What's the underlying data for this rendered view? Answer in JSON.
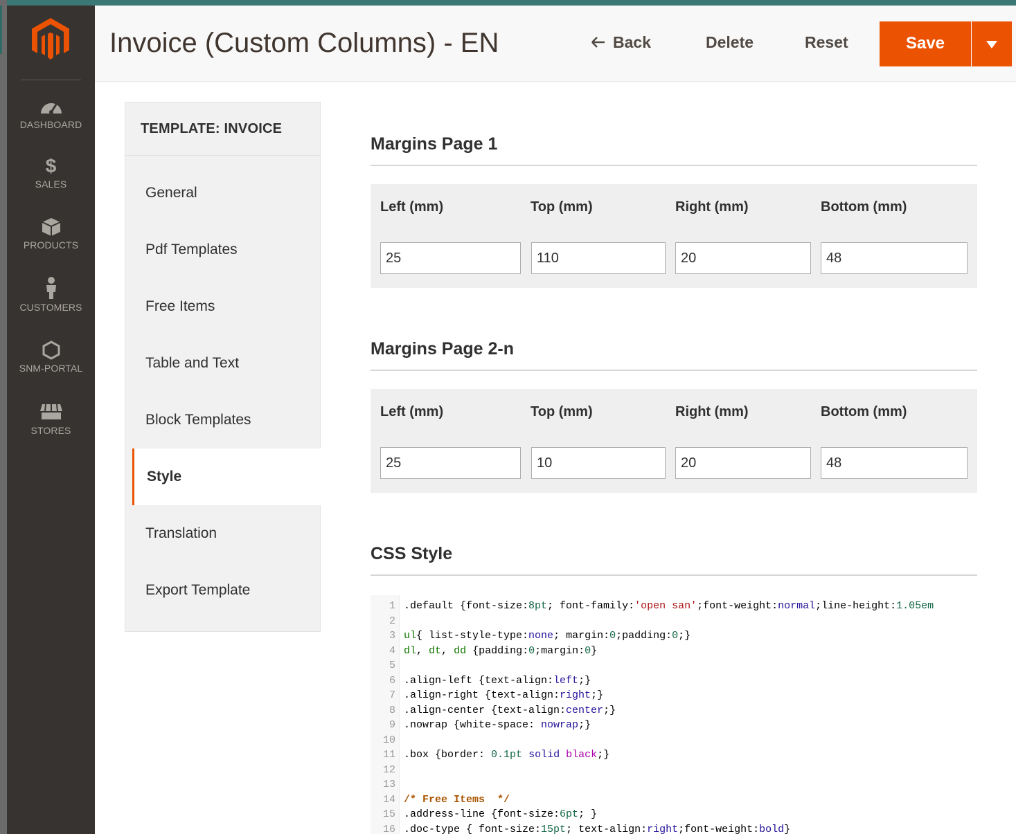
{
  "colors": {
    "accent": "#eb5202",
    "sidebar_bg": "#373330",
    "header_bg": "#f8f8f8"
  },
  "sidebar": {
    "logo_icon": "magento-logo-icon",
    "items": [
      {
        "label": "DASHBOARD",
        "icon": "dashboard-icon"
      },
      {
        "label": "SALES",
        "icon": "dollar-icon"
      },
      {
        "label": "PRODUCTS",
        "icon": "box-icon"
      },
      {
        "label": "CUSTOMERS",
        "icon": "person-icon"
      },
      {
        "label": "SNM-PORTAL",
        "icon": "hexagon-icon"
      },
      {
        "label": "STORES",
        "icon": "storefront-icon"
      }
    ]
  },
  "header": {
    "title": "Invoice (Custom Columns) - EN",
    "back_label": "Back",
    "delete_label": "Delete",
    "reset_label": "Reset",
    "save_label": "Save"
  },
  "tabs": {
    "title": "TEMPLATE: INVOICE",
    "items": [
      "General",
      "Pdf Templates",
      "Free Items",
      "Table and Text",
      "Block Templates",
      "Style",
      "Translation",
      "Export Template"
    ],
    "active": "Style"
  },
  "margins_page1": {
    "title": "Margins Page 1",
    "labels": [
      "Left (mm)",
      "Top (mm)",
      "Right (mm)",
      "Bottom (mm)"
    ],
    "values": [
      "25",
      "110",
      "20",
      "48"
    ]
  },
  "margins_page2": {
    "title": "Margins Page 2-n",
    "labels": [
      "Left (mm)",
      "Top (mm)",
      "Right (mm)",
      "Bottom (mm)"
    ],
    "values": [
      "25",
      "10",
      "20",
      "48"
    ]
  },
  "css_style": {
    "title": "CSS Style",
    "line_numbers": [
      "1",
      "2",
      "3",
      "4",
      "5",
      "6",
      "7",
      "8",
      "9",
      "10",
      "11",
      "12",
      "13",
      "14",
      "15",
      "16"
    ],
    "tokens": [
      [
        [
          ".default {font-size:",
          ""
        ],
        [
          "8pt",
          "num"
        ],
        [
          "; font-family:",
          ""
        ],
        [
          "'open san'",
          "str"
        ],
        [
          ";font-weight:",
          ""
        ],
        [
          "normal",
          "atom"
        ],
        [
          ";line-height:",
          ""
        ],
        [
          "1.05em",
          "num"
        ]
      ],
      [],
      [
        [
          "ul",
          "tag"
        ],
        [
          "{ list-style-type:",
          ""
        ],
        [
          "none",
          "atom"
        ],
        [
          "; margin:",
          ""
        ],
        [
          "0",
          "num"
        ],
        [
          ";padding:",
          ""
        ],
        [
          "0",
          "num"
        ],
        [
          ";}",
          ""
        ]
      ],
      [
        [
          "dl",
          "tag"
        ],
        [
          ", ",
          ""
        ],
        [
          "dt",
          "tag"
        ],
        [
          ", ",
          ""
        ],
        [
          "dd",
          "tag"
        ],
        [
          " {padding:",
          ""
        ],
        [
          "0",
          "num"
        ],
        [
          ";margin:",
          ""
        ],
        [
          "0",
          "num"
        ],
        [
          "}",
          ""
        ]
      ],
      [],
      [
        [
          ".align-left {text-align:",
          ""
        ],
        [
          "left",
          "atom"
        ],
        [
          ";}",
          ""
        ]
      ],
      [
        [
          ".align-right {text-align:",
          ""
        ],
        [
          "right",
          "atom"
        ],
        [
          ";}",
          ""
        ]
      ],
      [
        [
          ".align-center {text-align:",
          ""
        ],
        [
          "center",
          "atom"
        ],
        [
          ";}",
          ""
        ]
      ],
      [
        [
          ".nowrap {white-space: ",
          ""
        ],
        [
          "nowrap",
          "atom"
        ],
        [
          ";}",
          ""
        ]
      ],
      [],
      [
        [
          ".box {border: ",
          ""
        ],
        [
          "0.1pt",
          "num"
        ],
        [
          " ",
          ""
        ],
        [
          "solid",
          "atom"
        ],
        [
          " ",
          ""
        ],
        [
          "black",
          "purple"
        ],
        [
          ";}",
          ""
        ]
      ],
      [],
      [],
      [
        [
          "/* Free Items  */",
          "com"
        ]
      ],
      [
        [
          ".address-line {font-size:",
          ""
        ],
        [
          "6pt",
          "num"
        ],
        [
          "; }",
          ""
        ]
      ],
      [
        [
          ".doc-type { font-size:",
          ""
        ],
        [
          "15pt",
          "num"
        ],
        [
          "; text-align:",
          ""
        ],
        [
          "right",
          "atom"
        ],
        [
          ";font-weight:",
          ""
        ],
        [
          "bold",
          "atom"
        ],
        [
          "}",
          ""
        ]
      ]
    ]
  }
}
